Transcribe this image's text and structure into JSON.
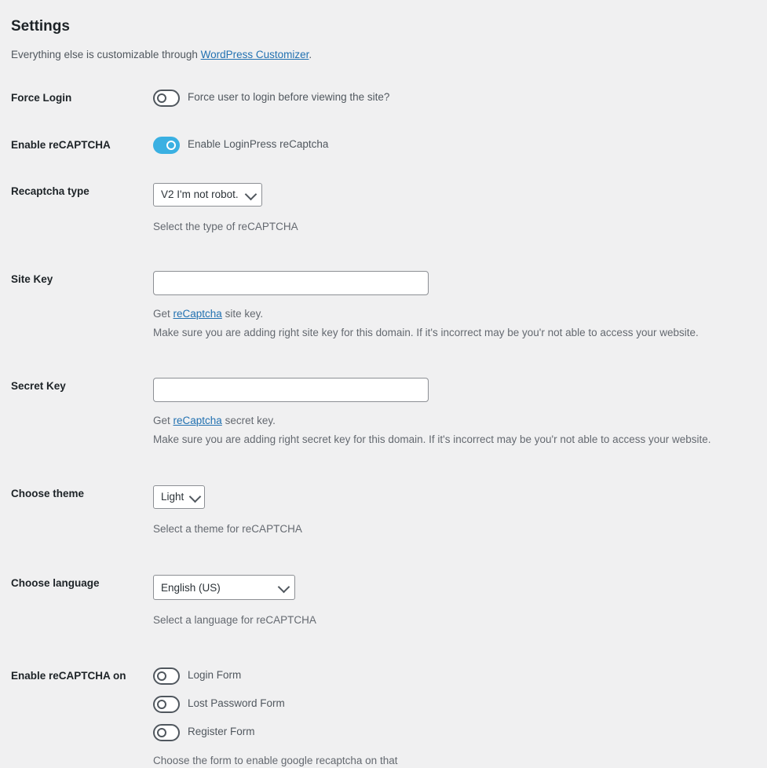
{
  "header": {
    "title": "Settings",
    "intro_before": "Everything else is customizable through ",
    "intro_link": "WordPress Customizer",
    "intro_after": "."
  },
  "force_login": {
    "label": "Force Login",
    "toggle_state": "off",
    "toggle_text": "Force user to login before viewing the site?"
  },
  "enable_recaptcha": {
    "label": "Enable reCAPTCHA",
    "toggle_state": "on",
    "toggle_text": "Enable LoginPress reCaptcha"
  },
  "recaptcha_type": {
    "label": "Recaptcha type",
    "selected": "V2 I'm not robot.",
    "description": "Select the type of reCAPTCHA"
  },
  "site_key": {
    "label": "Site Key",
    "value": "",
    "placeholder": "",
    "hint_before": "Get ",
    "hint_link": "reCaptcha",
    "hint_after": " site key.",
    "warning": "Make sure you are adding right site key for this domain. If it's incorrect may be you'r not able to access your website."
  },
  "secret_key": {
    "label": "Secret Key",
    "value": "",
    "placeholder": "",
    "hint_before": "Get ",
    "hint_link": "reCaptcha",
    "hint_after": " secret key.",
    "warning": "Make sure you are adding right secret key for this domain. If it's incorrect may be you'r not able to access your website."
  },
  "choose_theme": {
    "label": "Choose theme",
    "selected": "Light",
    "description": "Select a theme for reCAPTCHA"
  },
  "choose_language": {
    "label": "Choose language",
    "selected": "English (US)",
    "description": "Select a language for reCAPTCHA"
  },
  "recaptcha_on": {
    "label": "Enable reCAPTCHA on",
    "items": [
      {
        "name": "login-form",
        "text": "Login Form",
        "state": "off"
      },
      {
        "name": "lost-password-form",
        "text": "Lost Password Form",
        "state": "off"
      },
      {
        "name": "register-form",
        "text": "Register Form",
        "state": "off"
      }
    ],
    "description": "Choose the form to enable google recaptcha on that"
  },
  "colors": {
    "background": "#f0f0f1",
    "accent_toggle_on": "#3ab0e2",
    "link": "#2271b1",
    "label_text": "#1d2327",
    "body_text": "#50575e",
    "muted_text": "#646970"
  }
}
